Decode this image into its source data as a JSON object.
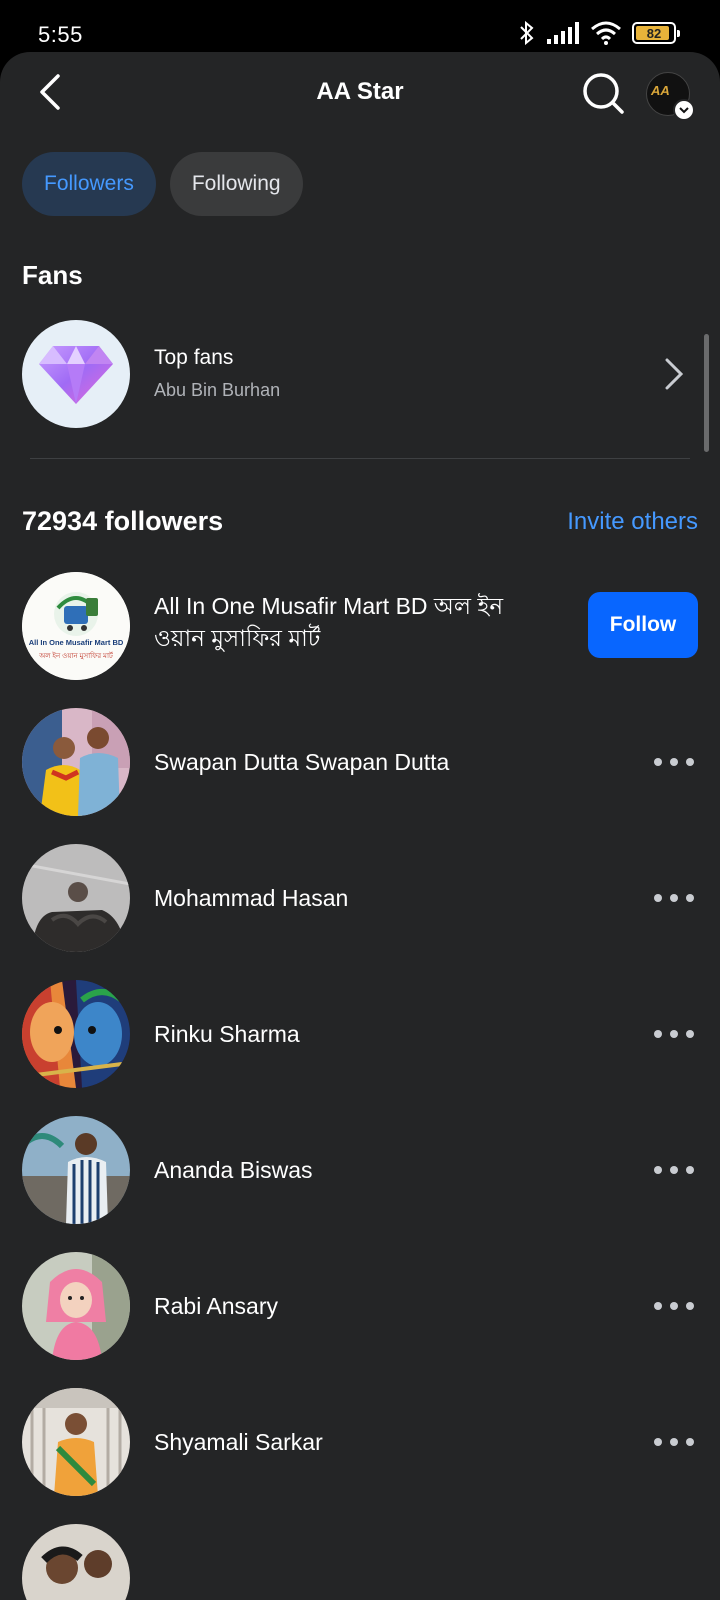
{
  "status_bar": {
    "time": "5:55",
    "battery": "82"
  },
  "header": {
    "title": "AA Star",
    "avatar_text": "AA"
  },
  "tabs": [
    {
      "label": "Followers",
      "active": true
    },
    {
      "label": "Following",
      "active": false
    }
  ],
  "fans": {
    "section_title": "Fans",
    "top_fans_title": "Top fans",
    "top_fans_name": "Abu Bin Burhan"
  },
  "followers": {
    "count_label": "72934 followers",
    "invite_label": "Invite others",
    "list": [
      {
        "name_line1": "All In One Musafir Mart BD অল ইন",
        "name_line2": "ওয়ান মুসাফির মার্ট",
        "action": "Follow",
        "logo_title": "All In One Musafir Mart BD",
        "logo_sub": "অল ইন ওয়ান মুসাফির মার্ট"
      },
      {
        "name": "Swapan Dutta Swapan Dutta"
      },
      {
        "name": "Mohammad Hasan"
      },
      {
        "name": "Rinku Sharma"
      },
      {
        "name": "Ananda Biswas"
      },
      {
        "name": "Rabi Ansary"
      },
      {
        "name": "Shyamali Sarkar"
      }
    ]
  },
  "colors": {
    "accent": "#4599ff",
    "follow_button": "#0866ff",
    "background": "#242526"
  }
}
